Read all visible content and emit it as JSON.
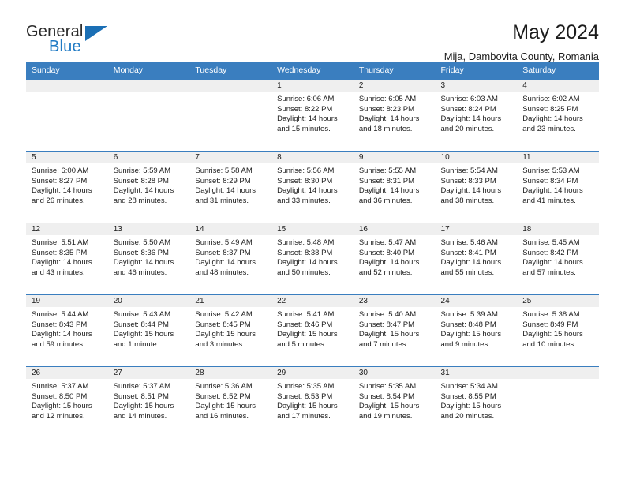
{
  "brand": {
    "name_top": "General",
    "name_bottom": "Blue",
    "accent_color": "#1b6fb5",
    "logo_icon": "triangle-flag-icon"
  },
  "header": {
    "title": "May 2024",
    "subtitle": "Mija, Dambovita County, Romania"
  },
  "calendar": {
    "header_bg": "#3a7ebf",
    "daynum_bg": "#efefef",
    "weekday_headers": [
      "Sunday",
      "Monday",
      "Tuesday",
      "Wednesday",
      "Thursday",
      "Friday",
      "Saturday"
    ],
    "weeks": [
      [
        {
          "day": "",
          "sunrise": "",
          "sunset": "",
          "daylight": "",
          "daylight2": ""
        },
        {
          "day": "",
          "sunrise": "",
          "sunset": "",
          "daylight": "",
          "daylight2": ""
        },
        {
          "day": "",
          "sunrise": "",
          "sunset": "",
          "daylight": "",
          "daylight2": ""
        },
        {
          "day": "1",
          "sunrise": "Sunrise: 6:06 AM",
          "sunset": "Sunset: 8:22 PM",
          "daylight": "Daylight: 14 hours",
          "daylight2": "and 15 minutes."
        },
        {
          "day": "2",
          "sunrise": "Sunrise: 6:05 AM",
          "sunset": "Sunset: 8:23 PM",
          "daylight": "Daylight: 14 hours",
          "daylight2": "and 18 minutes."
        },
        {
          "day": "3",
          "sunrise": "Sunrise: 6:03 AM",
          "sunset": "Sunset: 8:24 PM",
          "daylight": "Daylight: 14 hours",
          "daylight2": "and 20 minutes."
        },
        {
          "day": "4",
          "sunrise": "Sunrise: 6:02 AM",
          "sunset": "Sunset: 8:25 PM",
          "daylight": "Daylight: 14 hours",
          "daylight2": "and 23 minutes."
        }
      ],
      [
        {
          "day": "5",
          "sunrise": "Sunrise: 6:00 AM",
          "sunset": "Sunset: 8:27 PM",
          "daylight": "Daylight: 14 hours",
          "daylight2": "and 26 minutes."
        },
        {
          "day": "6",
          "sunrise": "Sunrise: 5:59 AM",
          "sunset": "Sunset: 8:28 PM",
          "daylight": "Daylight: 14 hours",
          "daylight2": "and 28 minutes."
        },
        {
          "day": "7",
          "sunrise": "Sunrise: 5:58 AM",
          "sunset": "Sunset: 8:29 PM",
          "daylight": "Daylight: 14 hours",
          "daylight2": "and 31 minutes."
        },
        {
          "day": "8",
          "sunrise": "Sunrise: 5:56 AM",
          "sunset": "Sunset: 8:30 PM",
          "daylight": "Daylight: 14 hours",
          "daylight2": "and 33 minutes."
        },
        {
          "day": "9",
          "sunrise": "Sunrise: 5:55 AM",
          "sunset": "Sunset: 8:31 PM",
          "daylight": "Daylight: 14 hours",
          "daylight2": "and 36 minutes."
        },
        {
          "day": "10",
          "sunrise": "Sunrise: 5:54 AM",
          "sunset": "Sunset: 8:33 PM",
          "daylight": "Daylight: 14 hours",
          "daylight2": "and 38 minutes."
        },
        {
          "day": "11",
          "sunrise": "Sunrise: 5:53 AM",
          "sunset": "Sunset: 8:34 PM",
          "daylight": "Daylight: 14 hours",
          "daylight2": "and 41 minutes."
        }
      ],
      [
        {
          "day": "12",
          "sunrise": "Sunrise: 5:51 AM",
          "sunset": "Sunset: 8:35 PM",
          "daylight": "Daylight: 14 hours",
          "daylight2": "and 43 minutes."
        },
        {
          "day": "13",
          "sunrise": "Sunrise: 5:50 AM",
          "sunset": "Sunset: 8:36 PM",
          "daylight": "Daylight: 14 hours",
          "daylight2": "and 46 minutes."
        },
        {
          "day": "14",
          "sunrise": "Sunrise: 5:49 AM",
          "sunset": "Sunset: 8:37 PM",
          "daylight": "Daylight: 14 hours",
          "daylight2": "and 48 minutes."
        },
        {
          "day": "15",
          "sunrise": "Sunrise: 5:48 AM",
          "sunset": "Sunset: 8:38 PM",
          "daylight": "Daylight: 14 hours",
          "daylight2": "and 50 minutes."
        },
        {
          "day": "16",
          "sunrise": "Sunrise: 5:47 AM",
          "sunset": "Sunset: 8:40 PM",
          "daylight": "Daylight: 14 hours",
          "daylight2": "and 52 minutes."
        },
        {
          "day": "17",
          "sunrise": "Sunrise: 5:46 AM",
          "sunset": "Sunset: 8:41 PM",
          "daylight": "Daylight: 14 hours",
          "daylight2": "and 55 minutes."
        },
        {
          "day": "18",
          "sunrise": "Sunrise: 5:45 AM",
          "sunset": "Sunset: 8:42 PM",
          "daylight": "Daylight: 14 hours",
          "daylight2": "and 57 minutes."
        }
      ],
      [
        {
          "day": "19",
          "sunrise": "Sunrise: 5:44 AM",
          "sunset": "Sunset: 8:43 PM",
          "daylight": "Daylight: 14 hours",
          "daylight2": "and 59 minutes."
        },
        {
          "day": "20",
          "sunrise": "Sunrise: 5:43 AM",
          "sunset": "Sunset: 8:44 PM",
          "daylight": "Daylight: 15 hours",
          "daylight2": "and 1 minute."
        },
        {
          "day": "21",
          "sunrise": "Sunrise: 5:42 AM",
          "sunset": "Sunset: 8:45 PM",
          "daylight": "Daylight: 15 hours",
          "daylight2": "and 3 minutes."
        },
        {
          "day": "22",
          "sunrise": "Sunrise: 5:41 AM",
          "sunset": "Sunset: 8:46 PM",
          "daylight": "Daylight: 15 hours",
          "daylight2": "and 5 minutes."
        },
        {
          "day": "23",
          "sunrise": "Sunrise: 5:40 AM",
          "sunset": "Sunset: 8:47 PM",
          "daylight": "Daylight: 15 hours",
          "daylight2": "and 7 minutes."
        },
        {
          "day": "24",
          "sunrise": "Sunrise: 5:39 AM",
          "sunset": "Sunset: 8:48 PM",
          "daylight": "Daylight: 15 hours",
          "daylight2": "and 9 minutes."
        },
        {
          "day": "25",
          "sunrise": "Sunrise: 5:38 AM",
          "sunset": "Sunset: 8:49 PM",
          "daylight": "Daylight: 15 hours",
          "daylight2": "and 10 minutes."
        }
      ],
      [
        {
          "day": "26",
          "sunrise": "Sunrise: 5:37 AM",
          "sunset": "Sunset: 8:50 PM",
          "daylight": "Daylight: 15 hours",
          "daylight2": "and 12 minutes."
        },
        {
          "day": "27",
          "sunrise": "Sunrise: 5:37 AM",
          "sunset": "Sunset: 8:51 PM",
          "daylight": "Daylight: 15 hours",
          "daylight2": "and 14 minutes."
        },
        {
          "day": "28",
          "sunrise": "Sunrise: 5:36 AM",
          "sunset": "Sunset: 8:52 PM",
          "daylight": "Daylight: 15 hours",
          "daylight2": "and 16 minutes."
        },
        {
          "day": "29",
          "sunrise": "Sunrise: 5:35 AM",
          "sunset": "Sunset: 8:53 PM",
          "daylight": "Daylight: 15 hours",
          "daylight2": "and 17 minutes."
        },
        {
          "day": "30",
          "sunrise": "Sunrise: 5:35 AM",
          "sunset": "Sunset: 8:54 PM",
          "daylight": "Daylight: 15 hours",
          "daylight2": "and 19 minutes."
        },
        {
          "day": "31",
          "sunrise": "Sunrise: 5:34 AM",
          "sunset": "Sunset: 8:55 PM",
          "daylight": "Daylight: 15 hours",
          "daylight2": "and 20 minutes."
        },
        {
          "day": "",
          "sunrise": "",
          "sunset": "",
          "daylight": "",
          "daylight2": ""
        }
      ]
    ]
  }
}
